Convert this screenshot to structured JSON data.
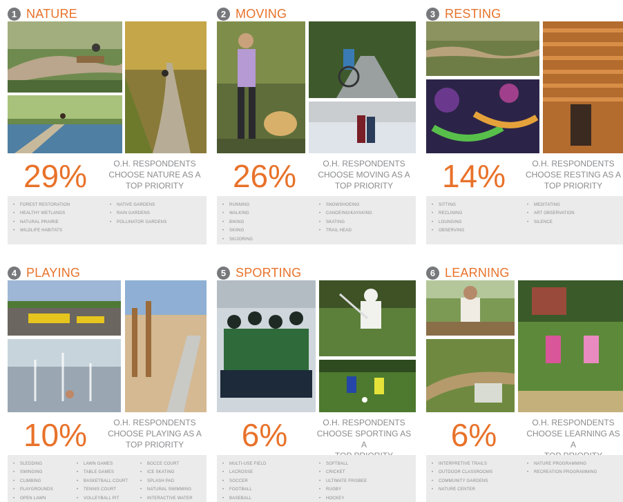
{
  "panels": [
    {
      "number": "1",
      "title": "NATURE",
      "percent": "29%",
      "caption": [
        "O.H. RESPONDENTS",
        "CHOOSE NATURE AS A",
        "TOP PRIORITY"
      ],
      "columns": [
        [
          "FOREST RESTORATION",
          "HEALTHY WETLANDS",
          "NATURAL PRAIRIE",
          "WILDLIFE HABITATS"
        ],
        [
          "NATIVE GARDENS",
          "RAIN GARDENS",
          "POLLINATOR GARDENS"
        ]
      ]
    },
    {
      "number": "2",
      "title": "MOVING",
      "percent": "26%",
      "caption": [
        "O.H. RESPONDENTS",
        "CHOOSE MOVING AS A",
        "TOP PRIORITY"
      ],
      "columns": [
        [
          "RUNNING",
          "WALKING",
          "BIKING",
          "SKIING",
          "SKIJORING"
        ],
        [
          "SNOWSHOEING",
          "CANOEING/KAYAKING",
          "SKATING",
          "TRAIL HEAD"
        ]
      ]
    },
    {
      "number": "3",
      "title": "RESTING",
      "percent": "14%",
      "caption": [
        "O.H. RESPONDENTS",
        "CHOOSE RESTING AS A",
        "TOP PRIORITY"
      ],
      "columns": [
        [
          "SITTING",
          "RECLINING",
          "LOUNGING",
          "OBSERVING"
        ],
        [
          "MEDITATING",
          "ART OBSERVATION",
          "SILENCE"
        ]
      ]
    },
    {
      "number": "4",
      "title": "PLAYING",
      "percent": "10%",
      "caption": [
        "O.H. RESPONDENTS",
        "CHOOSE PLAYING AS A",
        "TOP PRIORITY"
      ],
      "columns": [
        [
          "SLEDDING",
          "SWINGING",
          "CLIMBING",
          "PLAYGROUNDS",
          "OPEN LAWN"
        ],
        [
          "LAWN GAMES",
          "TABLE GAMES",
          "BASKETBALL COURT",
          "TENNIS COURT",
          "VOLLEYBALL PIT"
        ],
        [
          "BOCCE COURT",
          "ICE SKATING",
          "SPLASH PAD",
          "NATURAL SWIMMING",
          "INTERACTIVE WATER"
        ]
      ]
    },
    {
      "number": "5",
      "title": "SPORTING",
      "percent": "6%",
      "caption": [
        "O.H. RESPONDENTS",
        "CHOOSE SPORTING AS A",
        "TOP PRIORITY"
      ],
      "columns": [
        [
          "MULTI-USE FIELD",
          "LACROSSE",
          "SOCCER",
          "FOOTBALL",
          "BASEBALL"
        ],
        [
          "SOFTBALL",
          "CRICKET",
          "ULTIMATE FRISBEE",
          "RUGBY",
          "HOCKEY"
        ]
      ]
    },
    {
      "number": "6",
      "title": "LEARNING",
      "percent": "6%",
      "caption": [
        "O.H. RESPONDENTS",
        "CHOOSE LEARNING AS A",
        "TOP PRIORITY"
      ],
      "columns": [
        [
          "INTERPRETIVE TRAILS",
          "OUTDOOR CLASSROOMS",
          "COMMUNITY GARDENS",
          "NATURE CENTER"
        ],
        [
          "NATURE PROGRAMMING",
          "RECREATION PROGRAMMING"
        ]
      ]
    }
  ]
}
